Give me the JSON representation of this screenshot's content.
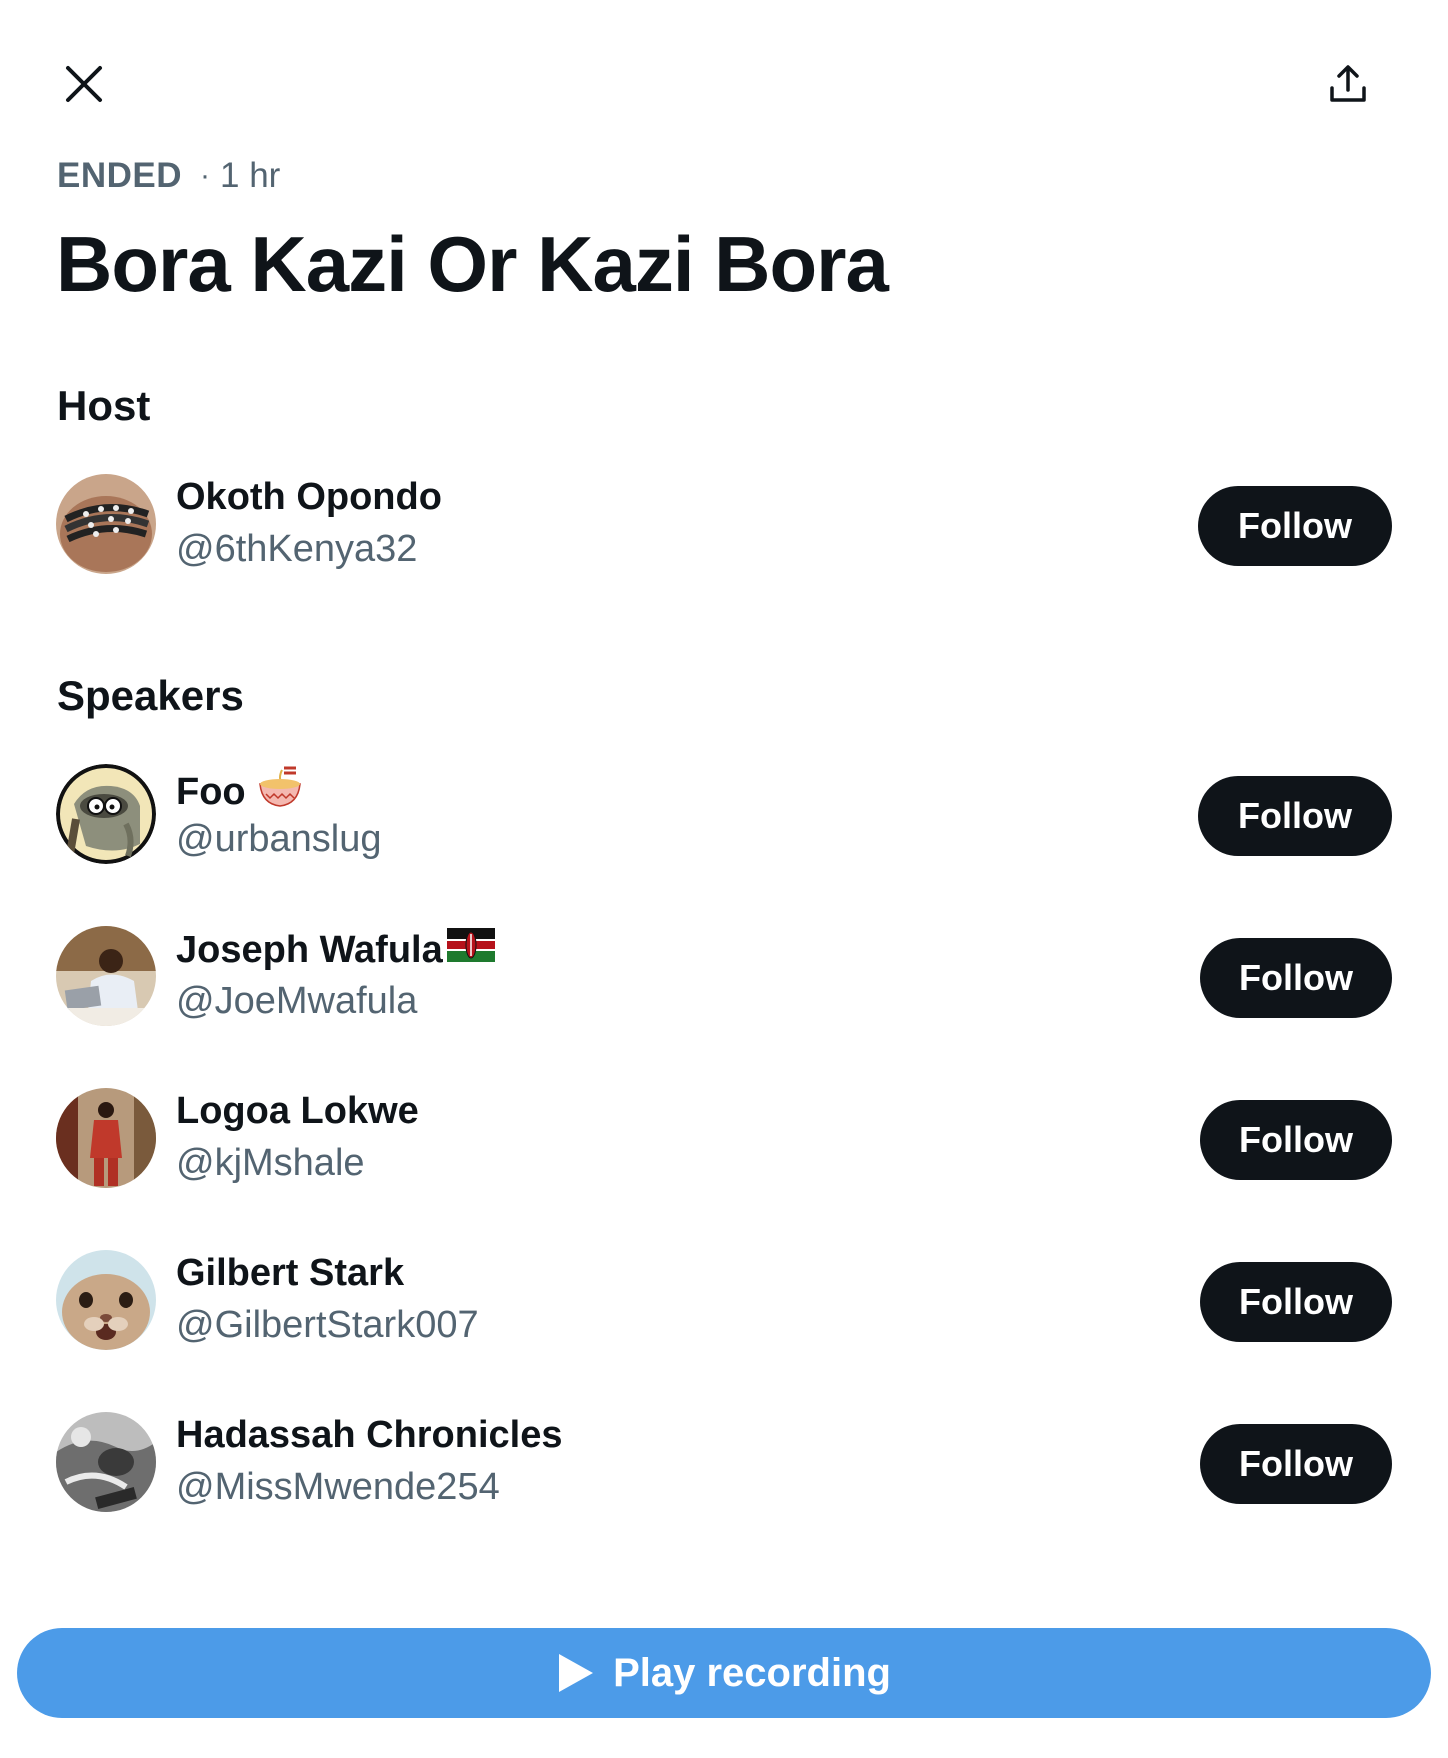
{
  "header": {
    "close_icon": "close-icon",
    "share_icon": "share-upload-icon"
  },
  "status": {
    "state": "ENDED",
    "separator": "·",
    "duration": "1 hr"
  },
  "space": {
    "title": "Bora Kazi Or Kazi Bora"
  },
  "host_section": {
    "heading": "Host",
    "host": {
      "name": "Okoth Opondo",
      "handle": "@6thKenya32",
      "avatar_icon": "bracelets-photo-avatar",
      "follow_label": "Follow"
    }
  },
  "speakers_section": {
    "heading": "Speakers",
    "speakers": [
      {
        "name": "Foo",
        "emoji": "ramen-bowl-icon",
        "handle": "@urbanslug",
        "avatar_icon": "cartoon-raccoon-avatar",
        "follow_label": "Follow"
      },
      {
        "name": "Joseph Wafula",
        "emoji": "kenya-flag-icon",
        "handle": "@JoeMwafula",
        "avatar_icon": "man-at-laptop-avatar",
        "follow_label": "Follow"
      },
      {
        "name": "Logoa Lokwe",
        "handle": "@kjMshale",
        "avatar_icon": "man-in-red-outfit-avatar",
        "follow_label": "Follow"
      },
      {
        "name": "Gilbert Stark",
        "handle": "@GilbertStark007",
        "avatar_icon": "rabbit-face-avatar",
        "follow_label": "Follow"
      },
      {
        "name": "Hadassah Chronicles",
        "handle": "@MissMwende254",
        "avatar_icon": "monochrome-photo-avatar",
        "follow_label": "Follow"
      }
    ]
  },
  "footer": {
    "play_label": "Play recording",
    "play_icon": "play-triangle-icon"
  },
  "colors": {
    "text_primary": "#0f1419",
    "text_secondary": "#536471",
    "follow_bg": "#0f1419",
    "play_bg": "#4c9be8"
  }
}
